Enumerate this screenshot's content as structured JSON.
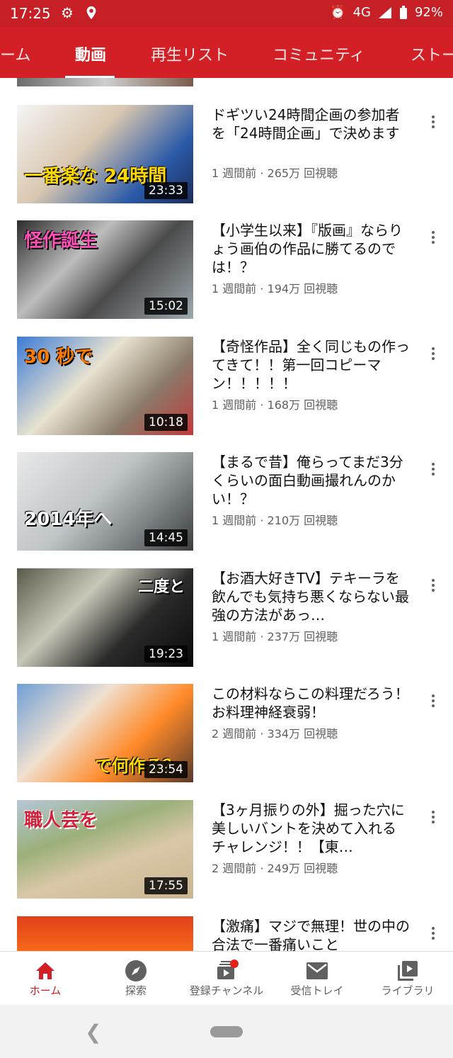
{
  "status": {
    "time": "17:25",
    "network": "4G",
    "battery": "92%"
  },
  "tabs": [
    {
      "label": "ーム"
    },
    {
      "label": "動画"
    },
    {
      "label": "再生リスト"
    },
    {
      "label": "コミュニティ"
    },
    {
      "label": "ストー"
    }
  ],
  "videos": [
    {
      "title": "ドギツい24時間企画の参加者を「24時間企画」で決めます",
      "meta": "1 週間前 · 265万 回視聴",
      "duration": "23:33",
      "caption": "一番楽な 24時間"
    },
    {
      "title": "【小学生以来】『版画』ならりょう画伯の作品に勝てるのでは！？",
      "meta": "1 週間前 · 194万 回視聴",
      "duration": "15:02",
      "caption": "怪作誕生"
    },
    {
      "title": "【奇怪作品】全く同じもの作ってきて！！第一回コピーマン！！！！！",
      "meta": "1 週間前 · 168万 回視聴",
      "duration": "10:18",
      "caption": "30 秒で"
    },
    {
      "title": "【まるで昔】俺らってまだ3分くらいの面白動画撮れんのかい！？",
      "meta": "1 週間前 · 210万 回視聴",
      "duration": "14:45",
      "caption": "2014年へ"
    },
    {
      "title": "【お酒大好きTV】テキーラを飲んでも気持ち悪くならない最強の方法があっ…",
      "meta": "1 週間前 · 237万 回視聴",
      "duration": "19:23",
      "caption": "二度と"
    },
    {
      "title": "この材料ならこの料理だろう！お料理神経衰弱！",
      "meta": "2 週間前 · 334万 回視聴",
      "duration": "23:54",
      "caption": "で何作る？"
    },
    {
      "title": "【3ヶ月振りの外】掘った穴に美しいバントを決めて入れるチャレンジ！！【東…",
      "meta": "2 週間前 · 249万 回視聴",
      "duration": "17:55",
      "caption": "職人芸を"
    },
    {
      "title": "【激痛】マジで無理！世の中の合法で一番痛いこと",
      "meta": "",
      "duration": "",
      "caption": ""
    }
  ],
  "bottom_nav": [
    {
      "label": "ホーム",
      "icon": "home-icon"
    },
    {
      "label": "探索",
      "icon": "explore-icon"
    },
    {
      "label": "登録チャンネル",
      "icon": "subscriptions-icon"
    },
    {
      "label": "受信トレイ",
      "icon": "inbox-icon"
    },
    {
      "label": "ライブラリ",
      "icon": "library-icon"
    }
  ],
  "colors": {
    "brand": "#d32027",
    "status_bar": "#c62026",
    "meta_text": "#606060"
  }
}
